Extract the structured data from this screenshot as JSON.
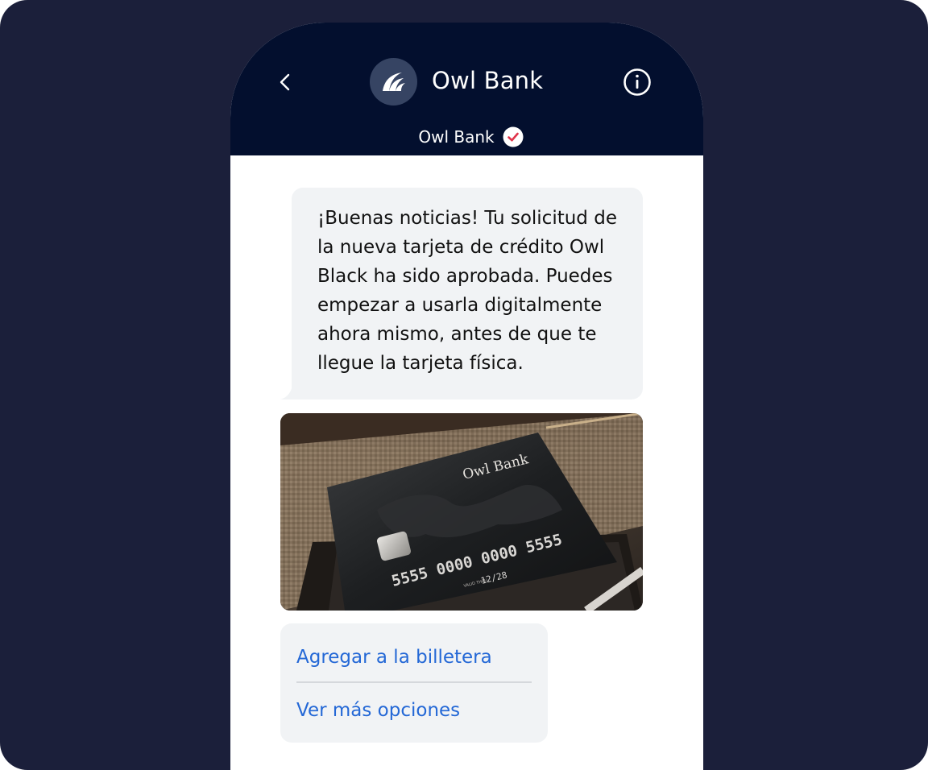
{
  "header": {
    "title": "Owl Bank",
    "subtitle": "Owl Bank"
  },
  "message": {
    "text": "¡Buenas noticias! Tu solicitud de la nueva tarjeta de crédito Owl Black ha sido aprobada. Puedes empezar a usarla digitalmente ahora mismo, antes de que te llegue la tarjeta física."
  },
  "card": {
    "brand": "Owl Bank",
    "number": "5555 0000 0000 5555",
    "valid_label": "VALID THRU",
    "expiry": "12/28"
  },
  "actions": [
    {
      "label": "Agregar a la billetera"
    },
    {
      "label": "Ver más opciones"
    }
  ],
  "icons": {
    "back": "chevron-left-icon",
    "info": "info-icon",
    "verified": "verified-check-icon",
    "avatar": "owl-bank-logo"
  },
  "colors": {
    "page_background": "#1b1f3a",
    "header_background": "#030f2e",
    "avatar_background": "#364463",
    "bubble_background": "#f1f3f5",
    "link": "#2468d6",
    "verified_check": "#e0344b"
  }
}
